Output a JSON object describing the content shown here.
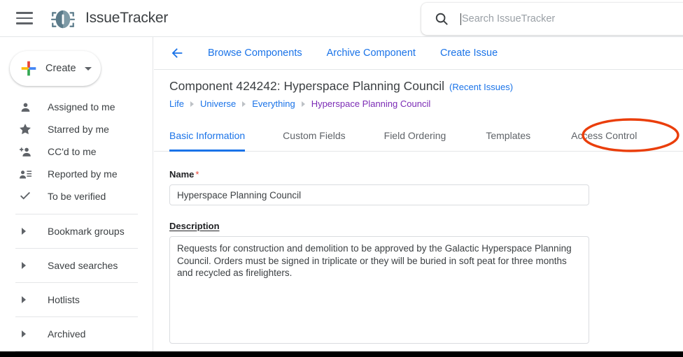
{
  "header": {
    "menu_icon": "hamburger-menu-icon",
    "logo_icon": "bug-icon",
    "brand": "IssueTracker",
    "search": {
      "icon": "search-icon",
      "placeholder": "Search IssueTracker",
      "value": ""
    }
  },
  "sidebar": {
    "create": {
      "label": "Create",
      "icon": "google-plus-icon",
      "caret": "chevron-down-icon"
    },
    "items": [
      {
        "label": "Assigned to me",
        "icon": "person-icon"
      },
      {
        "label": "Starred by me",
        "icon": "star-icon"
      },
      {
        "label": "CC'd to me",
        "icon": "person-add-icon"
      },
      {
        "label": "Reported by me",
        "icon": "person-list-icon"
      },
      {
        "label": "To be verified",
        "icon": "check-icon"
      }
    ],
    "groups": [
      {
        "label": "Bookmark groups",
        "icon": "caret-right-icon"
      },
      {
        "label": "Saved searches",
        "icon": "caret-right-icon"
      },
      {
        "label": "Hotlists",
        "icon": "caret-right-icon"
      },
      {
        "label": "Archived",
        "icon": "caret-right-icon"
      }
    ]
  },
  "main": {
    "back_icon": "arrow-left-icon",
    "actions": [
      "Browse Components",
      "Archive Component",
      "Create Issue"
    ],
    "title": "Component 424242: Hyperspace Planning Council",
    "recent_issues": "(Recent Issues)",
    "breadcrumb": [
      {
        "label": "Life",
        "visited": false
      },
      {
        "label": "Universe",
        "visited": false
      },
      {
        "label": "Everything",
        "visited": false
      },
      {
        "label": "Hyperspace Planning Council",
        "visited": true
      }
    ],
    "tabs": [
      {
        "label": "Basic Information",
        "active": true,
        "annotated": false
      },
      {
        "label": "Custom Fields",
        "active": false,
        "annotated": false
      },
      {
        "label": "Field Ordering",
        "active": false,
        "annotated": false
      },
      {
        "label": "Templates",
        "active": false,
        "annotated": false
      },
      {
        "label": "Access Control",
        "active": false,
        "annotated": true
      }
    ],
    "form": {
      "name_label": "Name",
      "name_required_marker": "*",
      "name_value": "Hyperspace Planning Council",
      "description_label": "Description",
      "description_value": "Requests for construction and demolition to be approved by the Galactic Hyperspace Planning Council. Orders must be signed in triplicate or they will be buried in soft peat for three months and recycled as firelighters."
    }
  },
  "colors": {
    "accent_blue": "#1a73e8",
    "visited_purple": "#7b2bb5",
    "annotation_red": "#ea3e0b",
    "required_red": "#ea4335",
    "text_primary": "#3c4043",
    "divider": "#e4e6e8"
  }
}
